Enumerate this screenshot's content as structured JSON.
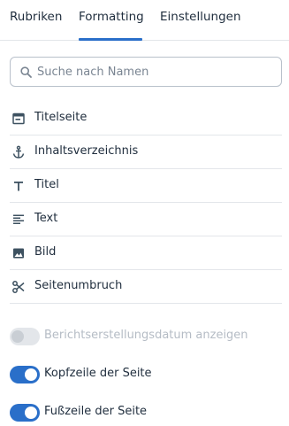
{
  "tabs": [
    {
      "label": "Rubriken"
    },
    {
      "label": "Formatting",
      "active": true
    },
    {
      "label": "Einstellungen"
    }
  ],
  "search": {
    "placeholder": "Suche nach Namen",
    "value": ""
  },
  "items": [
    {
      "label": "Titelseite",
      "icon": "title-page-icon"
    },
    {
      "label": "Inhaltsverzeichnis",
      "icon": "anchor-icon"
    },
    {
      "label": "Titel",
      "icon": "text-t-icon"
    },
    {
      "label": "Text",
      "icon": "paragraph-icon"
    },
    {
      "label": "Bild",
      "icon": "image-icon"
    },
    {
      "label": "Seitenumbruch",
      "icon": "scissors-icon"
    }
  ],
  "toggles": [
    {
      "label": "Berichtserstellungsdatum anzeigen",
      "on": false,
      "disabled": true
    },
    {
      "label": "Kopfzeile der Seite",
      "on": true,
      "disabled": false
    },
    {
      "label": "Fußzeile der Seite",
      "on": true,
      "disabled": false
    }
  ],
  "colors": {
    "accent": "#2a6fc9",
    "text": "#1f2d3d",
    "divider": "#e3e6ea",
    "icon": "#3d5160"
  }
}
